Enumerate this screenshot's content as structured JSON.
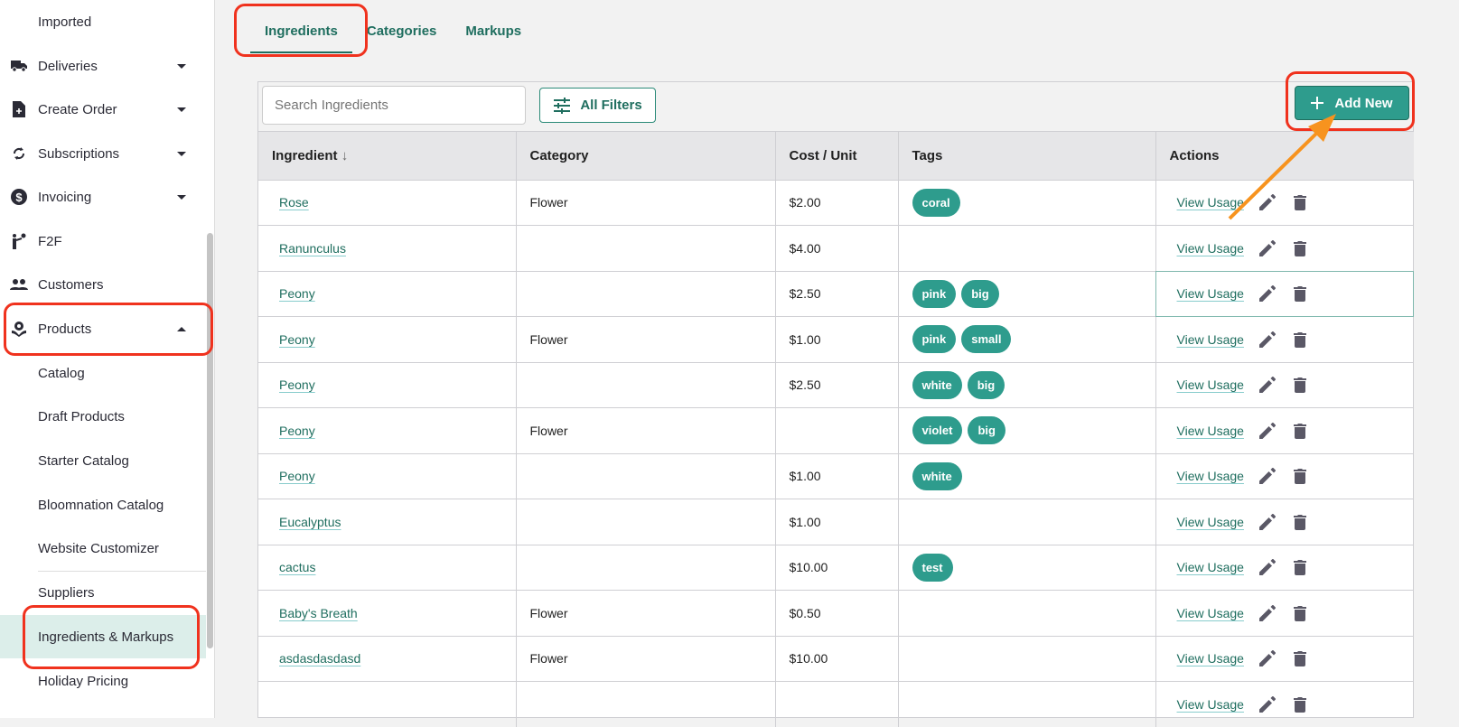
{
  "sidebar": {
    "items": [
      {
        "label": "Imported",
        "icon": "none"
      },
      {
        "label": "Deliveries",
        "icon": "truck-icon",
        "caret": "down"
      },
      {
        "label": "Create Order",
        "icon": "file-plus-icon",
        "caret": "down"
      },
      {
        "label": "Subscriptions",
        "icon": "sync-icon",
        "caret": "down"
      },
      {
        "label": "Invoicing",
        "icon": "dollar-circle-icon",
        "caret": "down"
      },
      {
        "label": "F2F",
        "icon": "person-flower-icon"
      },
      {
        "label": "Customers",
        "icon": "people-icon"
      },
      {
        "label": "Products",
        "icon": "flower-hand-icon",
        "caret": "up"
      },
      {
        "label": "Catalog"
      },
      {
        "label": "Draft Products"
      },
      {
        "label": "Starter Catalog"
      },
      {
        "label": "Bloomnation Catalog"
      },
      {
        "label": "Website Customizer"
      },
      {
        "label": "Suppliers"
      },
      {
        "label": "Ingredients & Markups",
        "active": true
      },
      {
        "label": "Holiday Pricing"
      }
    ]
  },
  "tabs": [
    "Ingredients",
    "Categories",
    "Markups"
  ],
  "toolbar": {
    "search_placeholder": "Search Ingredients",
    "filters_label": "All Filters",
    "add_label": "Add New"
  },
  "table": {
    "headers": [
      "Ingredient",
      "Category",
      "Cost / Unit",
      "Tags",
      "Actions"
    ],
    "view_usage": "View Usage",
    "rows": [
      {
        "name": "Rose",
        "category": "Flower",
        "cost": "$2.00",
        "tags": [
          "coral"
        ]
      },
      {
        "name": "Ranunculus",
        "category": "",
        "cost": "$4.00",
        "tags": []
      },
      {
        "name": "Peony",
        "category": "",
        "cost": "$2.50",
        "tags": [
          "pink",
          "big"
        ]
      },
      {
        "name": "Peony",
        "category": "Flower",
        "cost": "$1.00",
        "tags": [
          "pink",
          "small"
        ]
      },
      {
        "name": "Peony",
        "category": "",
        "cost": "$2.50",
        "tags": [
          "white",
          "big"
        ]
      },
      {
        "name": "Peony",
        "category": "Flower",
        "cost": "",
        "tags": [
          "violet",
          "big"
        ]
      },
      {
        "name": "Peony",
        "category": "",
        "cost": "$1.00",
        "tags": [
          "white"
        ]
      },
      {
        "name": "Eucalyptus",
        "category": "",
        "cost": "$1.00",
        "tags": []
      },
      {
        "name": "cactus",
        "category": "",
        "cost": "$10.00",
        "tags": [
          "test"
        ]
      },
      {
        "name": "Baby's Breath",
        "category": "Flower",
        "cost": "$0.50",
        "tags": []
      },
      {
        "name": "asdasdasdasd",
        "category": "Flower",
        "cost": "$10.00",
        "tags": []
      },
      {
        "name": "",
        "category": "",
        "cost": "",
        "tags": []
      }
    ]
  },
  "colors": {
    "accent": "#2e9c8d",
    "link": "#1f6e5f",
    "annotation_red": "#f0321e",
    "annotation_arrow": "#f7931e"
  }
}
